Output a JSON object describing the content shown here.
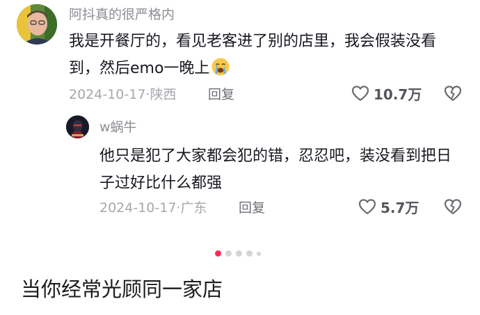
{
  "comment": {
    "username": "阿抖真的很严格内",
    "text": "我是开餐厅的，看见老客进了别的店里，我会假装没看到，然后emo一晚上",
    "emoji": "crying-face-icon",
    "date": "2024-10-17",
    "location": "陕西",
    "reply_label": "回复",
    "like_count": "10.7万"
  },
  "reply": {
    "username": "w蜗牛",
    "text": "他只是犯了大家都会犯的错，忍忍吧，装没看到把日子过好比什么都强",
    "date": "2024-10-17",
    "location": "广东",
    "reply_label": "回复",
    "like_count": "5.7万"
  },
  "pagination": {
    "total": 5,
    "active": 0,
    "accent": "#fe2c55"
  },
  "caption": "当你经常光顾同一家店"
}
